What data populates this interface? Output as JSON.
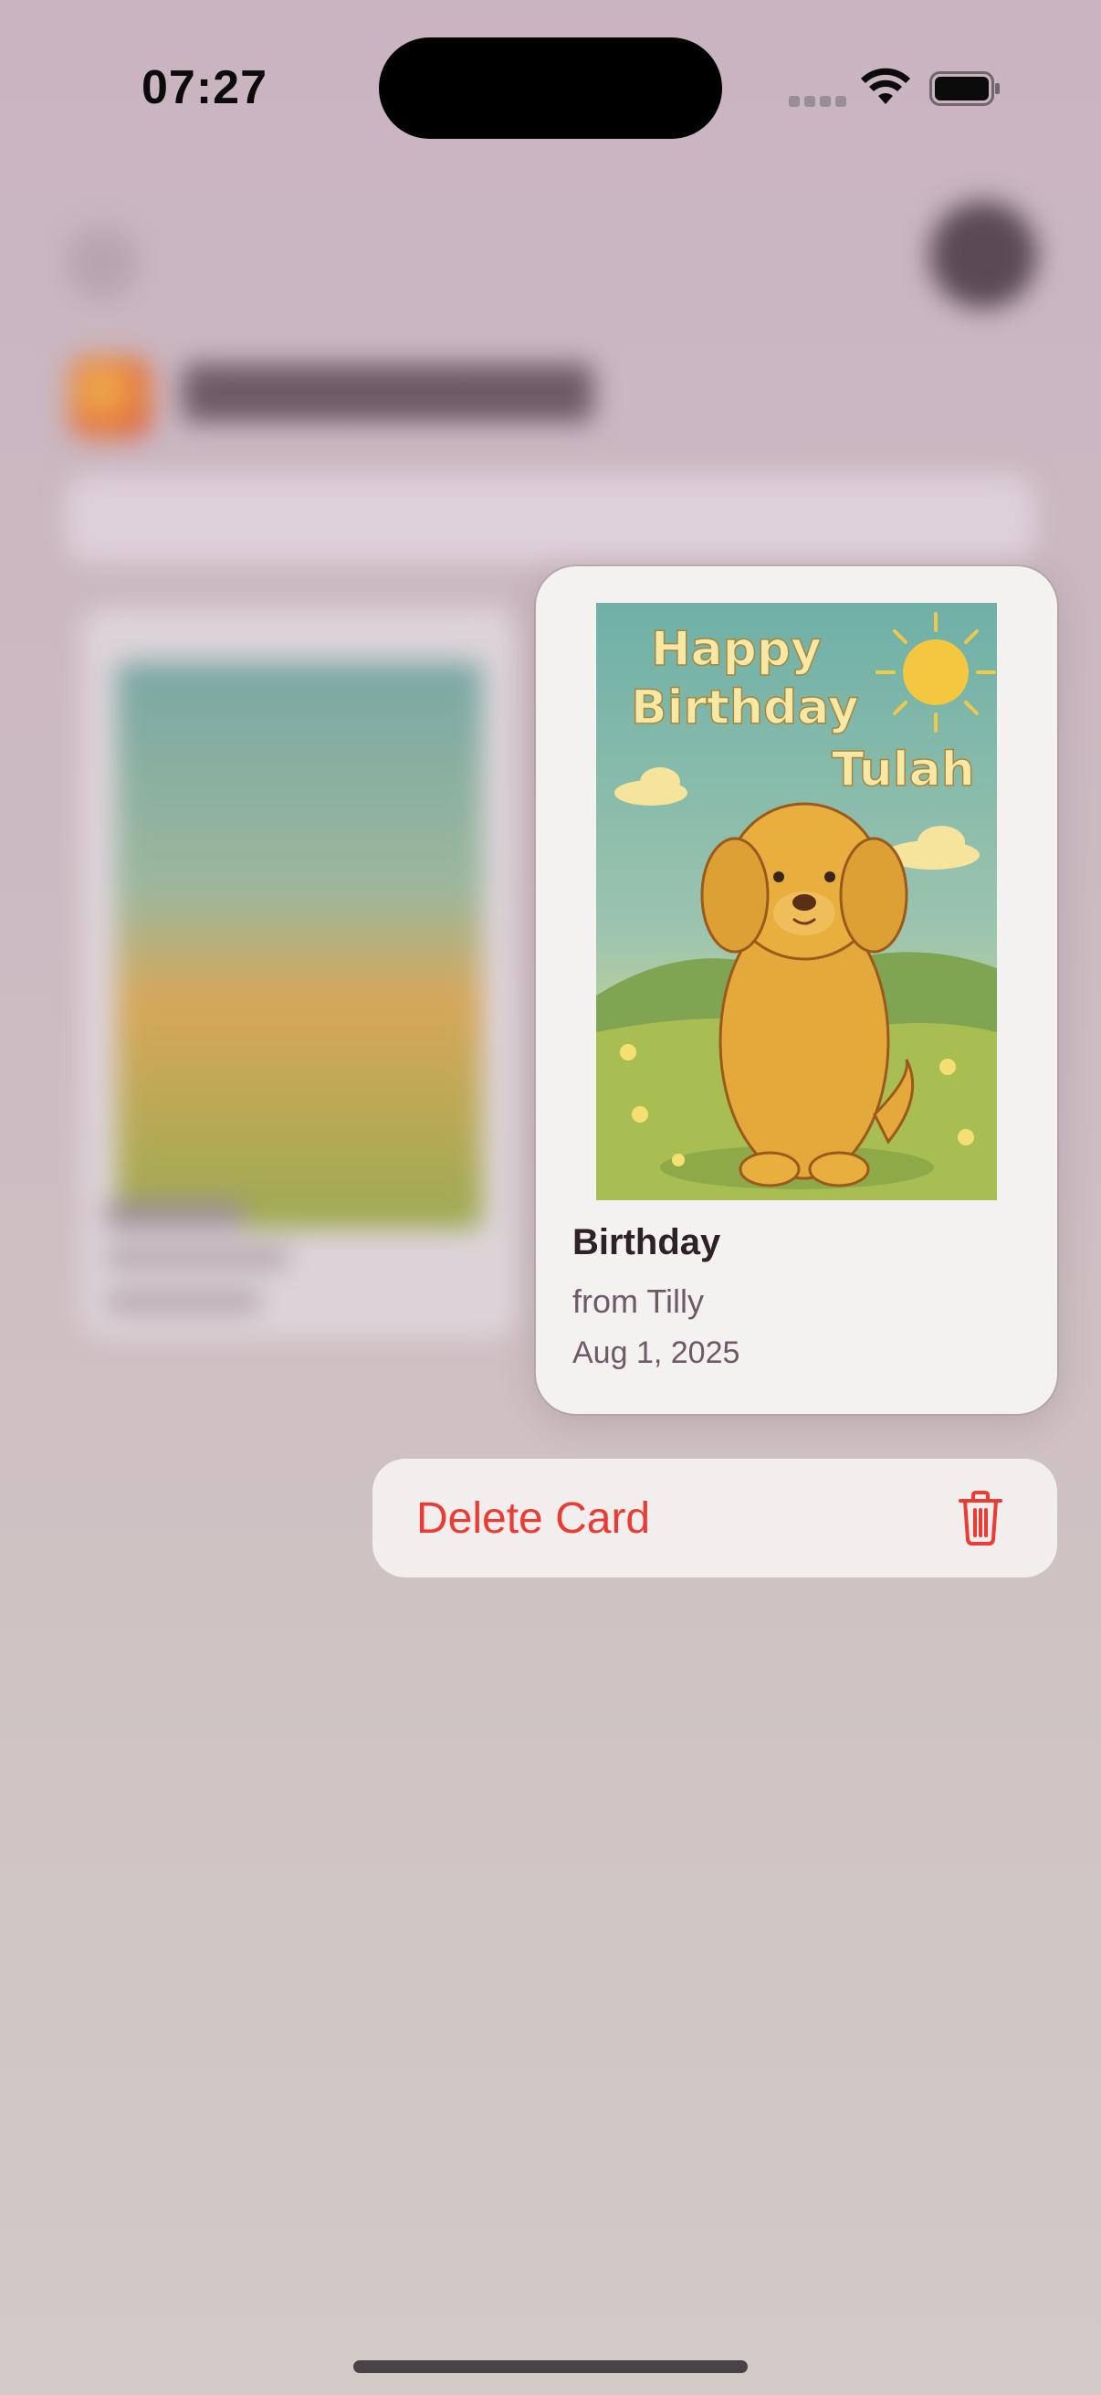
{
  "status_bar": {
    "time": "07:27"
  },
  "card": {
    "title": "Birthday",
    "from": "from Tilly",
    "date": "Aug 1, 2025",
    "image_text": [
      "Happy",
      "Birthday",
      "Tulah"
    ]
  },
  "menu": {
    "delete_label": "Delete Card"
  },
  "colors": {
    "destructive": "#eb3b32",
    "card_bg": "#f4f1f1"
  }
}
